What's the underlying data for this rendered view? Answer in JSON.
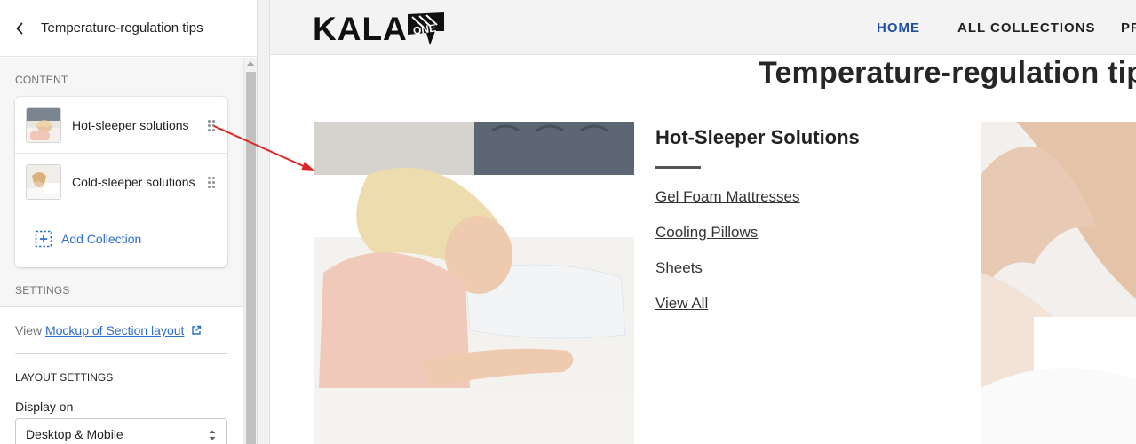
{
  "editor": {
    "title": "Temperature-regulation tips",
    "content_label": "CONTENT",
    "items": [
      {
        "label": "Hot-sleeper solutions"
      },
      {
        "label": "Cold-sleeper solutions"
      }
    ],
    "add_label": "Add Collection",
    "settings_label": "SETTINGS",
    "view_prefix": "View",
    "mockup_link": "Mockup of Section layout",
    "layout_settings_label": "LAYOUT SETTINGS",
    "display_on_label": "Display on",
    "display_on_value": "Desktop & Mobile"
  },
  "preview": {
    "logo_text": "KALA",
    "logo_badge": "ONE",
    "nav": {
      "home": "HOME",
      "collections": "ALL COLLECTIONS",
      "more": "PR"
    },
    "section_title": "Temperature-regulation tips",
    "collection": {
      "heading": "Hot-Sleeper Solutions",
      "links": [
        "Gel Foam Mattresses",
        "Cooling Pillows",
        "Sheets",
        "View All"
      ]
    }
  },
  "colors": {
    "accent_link": "#2c6ecb",
    "nav_active": "#1f4fa3",
    "arrow": "#e02424"
  }
}
